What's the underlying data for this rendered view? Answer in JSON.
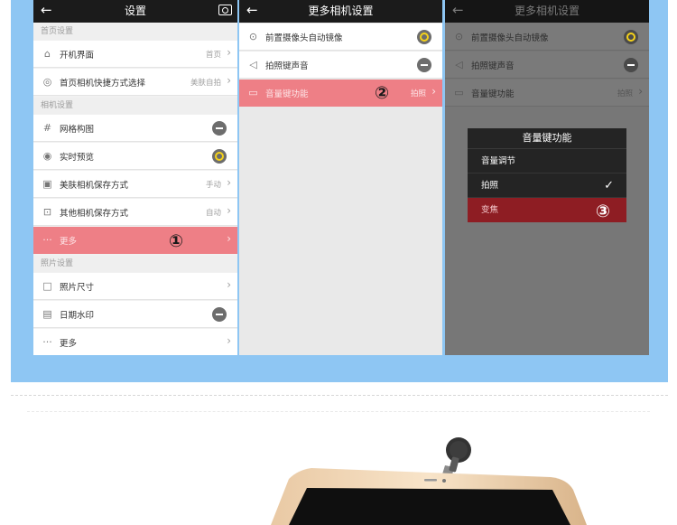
{
  "panel1": {
    "title": "设置",
    "sections": [
      "首页设置",
      "相机设置",
      "照片设置"
    ],
    "rows": [
      {
        "icon": "⌂",
        "label": "开机界面",
        "value": "首页"
      },
      {
        "icon": "◎",
        "label": "首页相机快捷方式选择",
        "value": "美肤自拍"
      },
      {
        "icon": "#",
        "label": "网格构图",
        "value": ""
      },
      {
        "icon": "◉",
        "label": "实时预览",
        "value": ""
      },
      {
        "icon": "▣",
        "label": "美肤相机保存方式",
        "value": "手动"
      },
      {
        "icon": "⊡",
        "label": "其他相机保存方式",
        "value": "自动"
      },
      {
        "icon": "···",
        "label": "更多",
        "value": ""
      },
      {
        "icon": "□",
        "label": "照片尺寸",
        "value": ""
      },
      {
        "icon": "▤",
        "label": "日期水印",
        "value": ""
      },
      {
        "icon": "···",
        "label": "更多",
        "value": ""
      }
    ],
    "marker": "①"
  },
  "panel2": {
    "title": "更多相机设置",
    "rows": [
      {
        "icon": "⊙",
        "label": "前置摄像头自动镜像",
        "value": ""
      },
      {
        "icon": "◁",
        "label": "拍照键声音",
        "value": ""
      },
      {
        "icon": "▭",
        "label": "音量键功能",
        "value": "拍照"
      }
    ],
    "marker": "②"
  },
  "panel3": {
    "title": "更多相机设置",
    "rows": [
      {
        "icon": "⊙",
        "label": "前置摄像头自动镜像",
        "value": ""
      },
      {
        "icon": "◁",
        "label": "拍照键声音",
        "value": ""
      },
      {
        "icon": "▭",
        "label": "音量键功能",
        "value": "拍照"
      }
    ],
    "dialog": {
      "title": "音量键功能",
      "options": [
        "音量调节",
        "拍照",
        "变焦"
      ]
    },
    "marker": "③"
  },
  "colors": {
    "accent_blue": "#8ec6f3",
    "highlight_pink": "#ee7f86",
    "selected_red": "#8e1d23",
    "topbar": "#1b1b1b"
  }
}
